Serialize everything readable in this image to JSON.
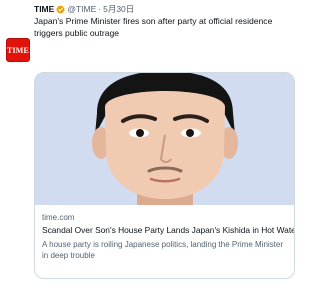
{
  "tweet": {
    "avatar_text": "TIME",
    "author_name": "TIME",
    "handle": "@TIME",
    "separator": "·",
    "date": "5月30日",
    "text": "Japan's Prime Minister fires son after party at official residence triggers public outrage"
  },
  "card": {
    "domain": "time.com",
    "title": "Scandal Over Son's House Party Lands Japan's Kishida in Hot Water",
    "description": "A house party is roiling Japanese politics, landing the Prime Minister in deep trouble"
  },
  "colors": {
    "brand": "#e3120b",
    "verified": "#e8a20c",
    "photo_background": "#c9d6ee"
  },
  "icons": [
    "verified-badge-icon"
  ]
}
